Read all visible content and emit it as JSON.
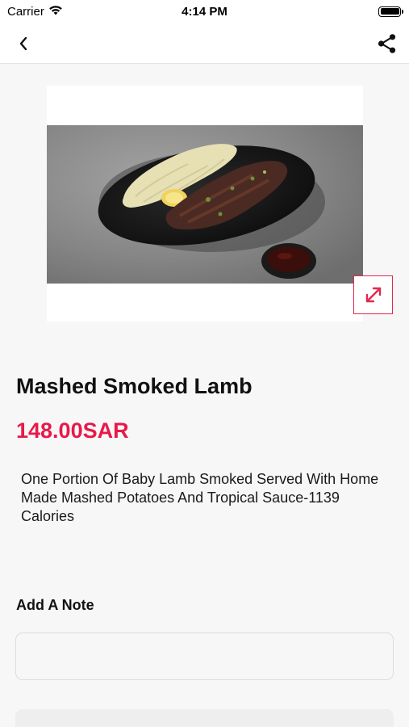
{
  "status_bar": {
    "carrier": "Carrier",
    "time": "4:14 PM"
  },
  "nav": {
    "back_icon": "chevron-left-icon",
    "share_icon": "share-icon"
  },
  "product": {
    "image_alt": "Mashed smoked lamb dish",
    "expand_icon": "expand-icon",
    "title": "Mashed Smoked Lamb",
    "price": "148.00SAR",
    "description": "One Portion Of Baby Lamb Smoked Served With Home Made Mashed Potatoes And Tropical Sauce-1139 Calories"
  },
  "note": {
    "label": "Add A Note",
    "value": "",
    "placeholder": ""
  },
  "colors": {
    "accent": "#e8194a",
    "background": "#f7f7f7"
  }
}
